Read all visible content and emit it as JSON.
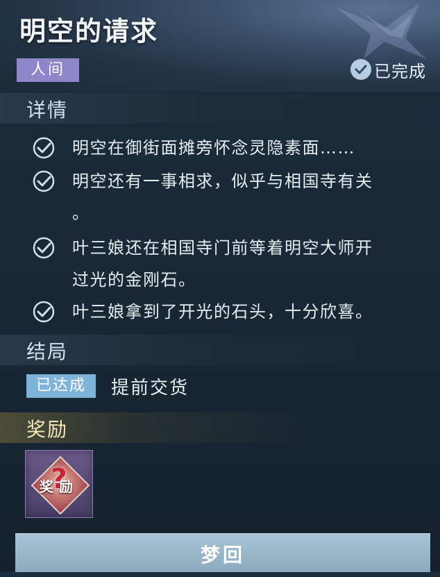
{
  "header": {
    "title": "明空的请求",
    "tag": "人间",
    "status": "已完成"
  },
  "details": {
    "title": "详情",
    "items": [
      {
        "lines": [
          "明空在御街面摊旁怀念灵隐素面……"
        ]
      },
      {
        "lines": [
          "明空还有一事相求，似乎与相国寺有关",
          "。"
        ]
      },
      {
        "lines": [
          "叶三娘还在相国寺门前等着明空大师开",
          "过光的金刚石。"
        ]
      },
      {
        "lines": [
          "叶三娘拿到了开光的石头，十分欣喜。"
        ]
      }
    ]
  },
  "outcome": {
    "title": "结局",
    "badge": "已达成",
    "text": "提前交货"
  },
  "rewards": {
    "title": "奖励",
    "items": [
      {
        "label": "奖励",
        "glyph": "?",
        "icon": "mystery-reward-icon"
      }
    ]
  },
  "action": {
    "label": "梦回"
  },
  "colors": {
    "tag_bg": "#8e86c8",
    "achieved_bg": "#7fb4d8",
    "button_bg": "#9cb8cc",
    "check": "#b9cde1"
  }
}
